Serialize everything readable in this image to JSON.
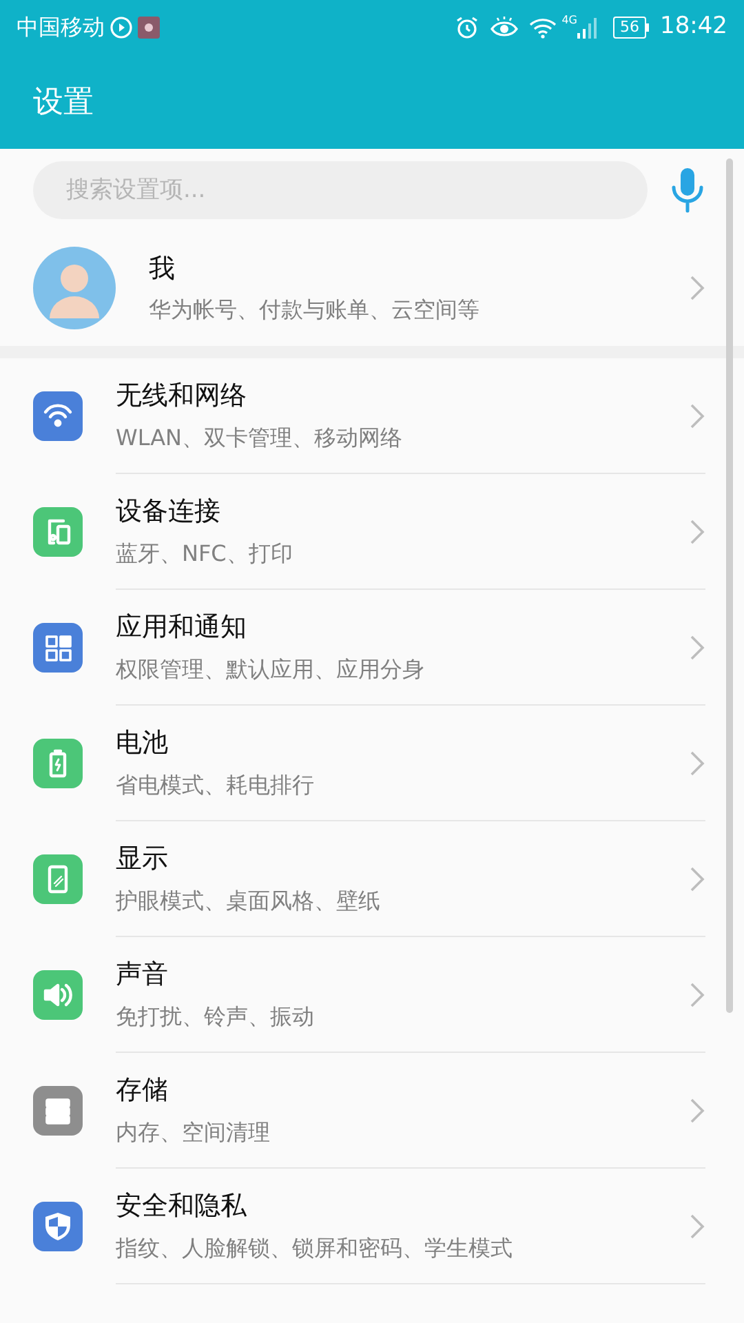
{
  "status_bar": {
    "carrier": "中国移动",
    "network": "4G",
    "battery": "56",
    "time": "18:42"
  },
  "header": {
    "title": "设置"
  },
  "search": {
    "placeholder": "搜索设置项..."
  },
  "profile": {
    "name": "我",
    "subtitle": "华为帐号、付款与账单、云空间等"
  },
  "items": [
    {
      "kind": "wifi",
      "color": "#4a80d9",
      "title": "无线和网络",
      "subtitle": "WLAN、双卡管理、移动网络"
    },
    {
      "kind": "devices",
      "color": "#4cc678",
      "title": "设备连接",
      "subtitle": "蓝牙、NFC、打印"
    },
    {
      "kind": "apps",
      "color": "#4a80d9",
      "title": "应用和通知",
      "subtitle": "权限管理、默认应用、应用分身"
    },
    {
      "kind": "battery",
      "color": "#4cc678",
      "title": "电池",
      "subtitle": "省电模式、耗电排行"
    },
    {
      "kind": "display",
      "color": "#4cc678",
      "title": "显示",
      "subtitle": "护眼模式、桌面风格、壁纸"
    },
    {
      "kind": "sound",
      "color": "#4cc678",
      "title": "声音",
      "subtitle": "免打扰、铃声、振动"
    },
    {
      "kind": "storage",
      "color": "#8e8e8e",
      "title": "存储",
      "subtitle": "内存、空间清理"
    },
    {
      "kind": "security",
      "color": "#4a80d9",
      "title": "安全和隐私",
      "subtitle": "指纹、人脸解锁、锁屏和密码、学生模式"
    }
  ]
}
